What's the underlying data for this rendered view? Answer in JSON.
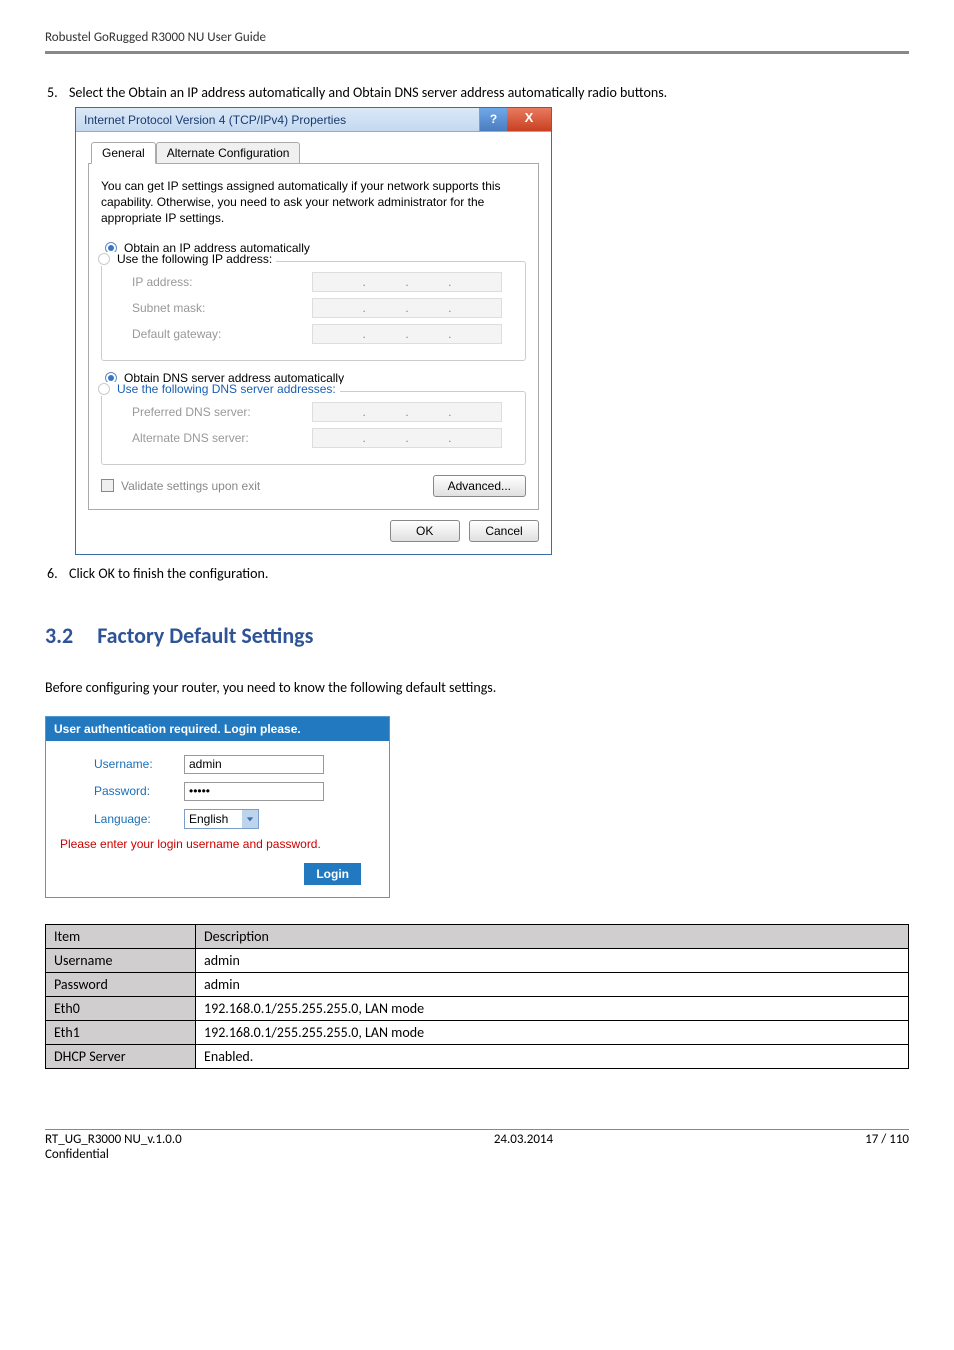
{
  "doc_header": "Robustel GoRugged R3000 NU User Guide",
  "step5": {
    "num": "5.",
    "text": "Select the Obtain an IP address automatically and Obtain DNS server address automatically radio buttons."
  },
  "dialog": {
    "title": "Internet Protocol Version 4 (TCP/IPv4) Properties",
    "help_char": "?",
    "close_char": "X",
    "tab_general": "General",
    "tab_alternate": "Alternate Configuration",
    "desc": "You can get IP settings assigned automatically if your network supports this capability. Otherwise, you need to ask your network administrator for the appropriate IP settings.",
    "radio_auto_ip": "Obtain an IP address automatically",
    "radio_use_ip": "Use the following IP address:",
    "field_ip": "IP address:",
    "field_subnet": "Subnet mask:",
    "field_gateway": "Default gateway:",
    "radio_auto_dns": "Obtain DNS server address automatically",
    "radio_use_dns": "Use the following DNS server addresses:",
    "field_pref_dns": "Preferred DNS server:",
    "field_alt_dns": "Alternate DNS server:",
    "check_validate": "Validate settings upon exit",
    "btn_advanced": "Advanced...",
    "btn_ok": "OK",
    "btn_cancel": "Cancel"
  },
  "step6": {
    "num": "6.",
    "text": "Click OK to finish the configuration."
  },
  "section32": {
    "num": "3.2",
    "title": "Factory Default Settings"
  },
  "para_before": "Before configuring your router, you need to know the following default settings.",
  "login": {
    "title": "User authentication required. Login please.",
    "label_user": "Username:",
    "value_user": "admin",
    "label_pass": "Password:",
    "value_pass": "•••••",
    "label_lang": "Language:",
    "value_lang": "English",
    "msg": "Please enter your login username and password.",
    "btn": "Login"
  },
  "desc_table": {
    "h_item": "Item",
    "h_desc": "Description",
    "rows": [
      {
        "item": "Username",
        "desc": "admin"
      },
      {
        "item": "Password",
        "desc": "admin"
      },
      {
        "item": "Eth0",
        "desc": "192.168.0.1/255.255.255.0, LAN mode"
      },
      {
        "item": "Eth1",
        "desc": "192.168.0.1/255.255.255.0, LAN mode"
      },
      {
        "item": "DHCP Server",
        "desc": "Enabled."
      }
    ]
  },
  "footer": {
    "left1": "RT_UG_R3000 NU_v.1.0.0",
    "center1": "24.03.2014",
    "right1": "17 / 110",
    "left2": "Confidential"
  }
}
